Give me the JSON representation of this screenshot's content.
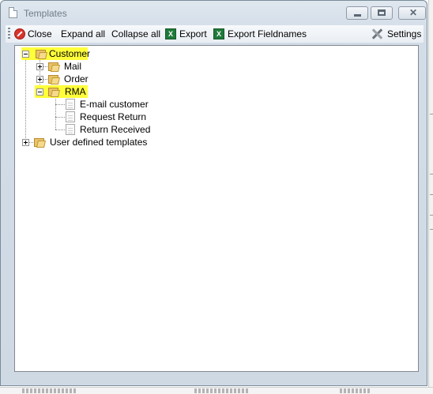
{
  "window": {
    "title": "Templates",
    "controls": {
      "minimize": "▁",
      "maximize": "□",
      "close": "✕"
    }
  },
  "toolbar": {
    "close_label": "Close",
    "expand_all_label": "Expand all",
    "collapse_all_label": "Collapse all",
    "export_label": "Export",
    "export_fieldnames_label": "Export Fieldnames",
    "settings_label": "Settings",
    "xls_glyph": "X"
  },
  "tree": {
    "root": {
      "label": "Customer",
      "expanded": true,
      "highlighted": true
    },
    "mail": {
      "label": "Mail",
      "expanded": false
    },
    "order": {
      "label": "Order",
      "expanded": false
    },
    "rma": {
      "label": "RMA",
      "expanded": true,
      "highlighted": true
    },
    "rma_items": [
      "E-mail customer",
      "Request Return",
      "Return Received"
    ],
    "user_defined": {
      "label": "User defined templates",
      "expanded": false
    }
  },
  "colors": {
    "highlight": "#ffff3a",
    "close_icon": "#d7342c",
    "excel_icon": "#1f7a3a"
  }
}
